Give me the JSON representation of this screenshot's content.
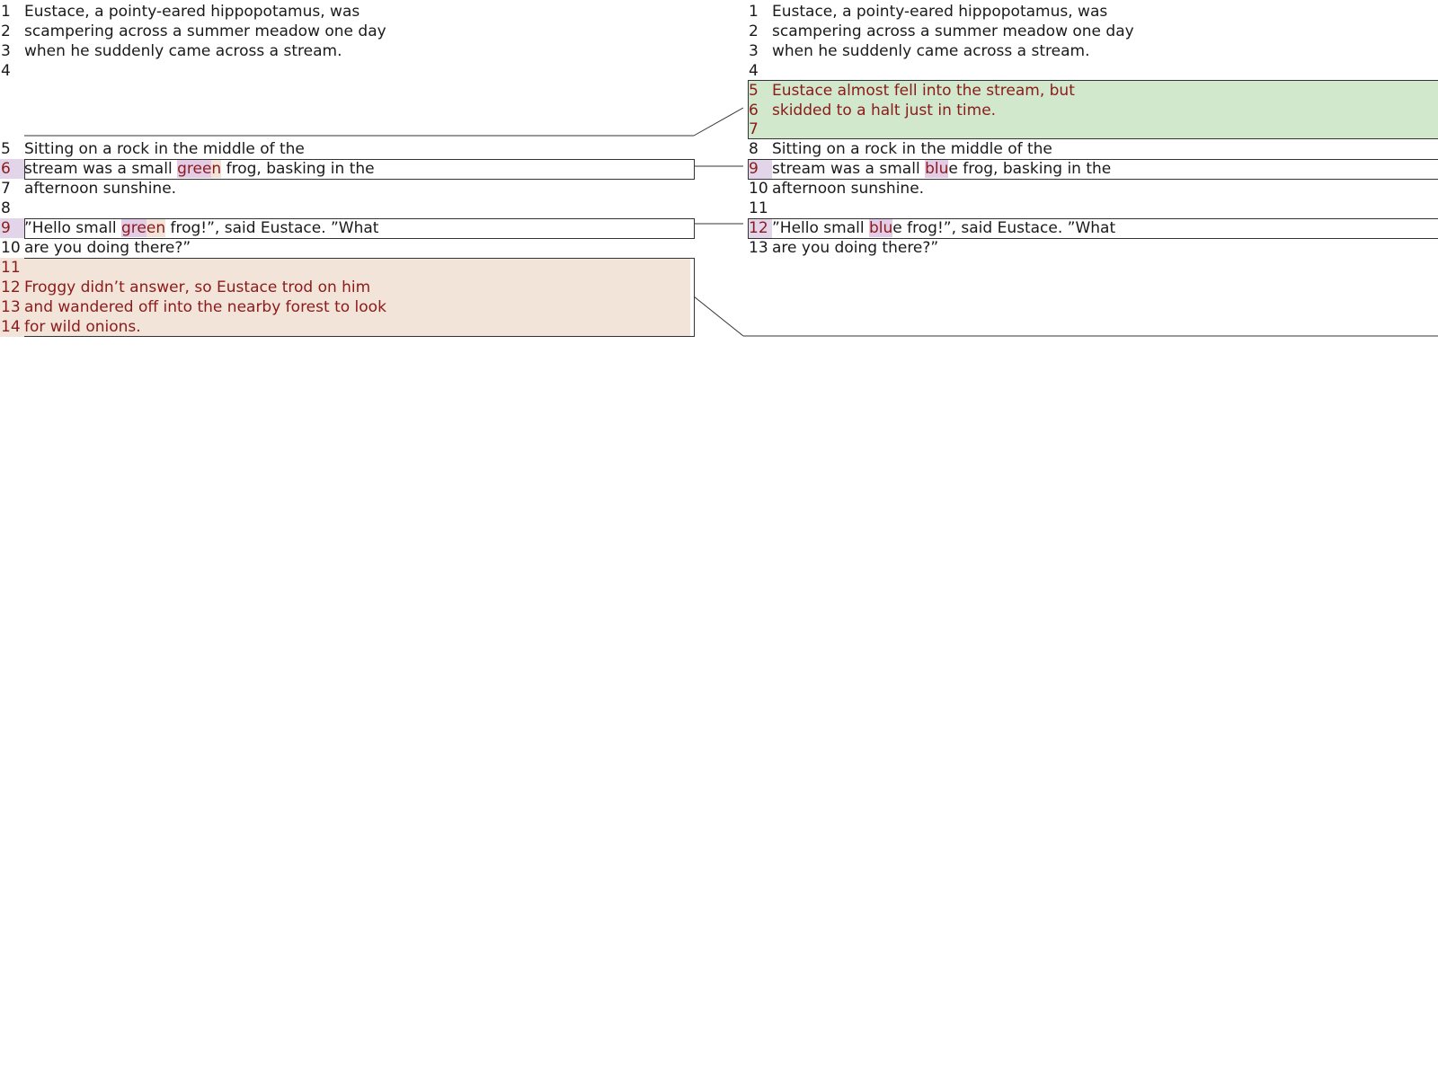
{
  "left": {
    "l1": {
      "num": "1",
      "text": "Eustace, a pointy-eared hippopotamus, was"
    },
    "l2": {
      "num": "2",
      "text": "scampering across a summer meadow one day"
    },
    "l3": {
      "num": "3",
      "text": "when he suddenly came across a stream."
    },
    "l4": {
      "num": "4",
      "text": ""
    },
    "l5": {
      "num": "5",
      "text": "Sitting on a rock in the middle of the"
    },
    "l6": {
      "num": "6",
      "pre": "stream was a small ",
      "changed": "gree",
      "tail": "n",
      "post": " frog, basking in the"
    },
    "l7": {
      "num": "7",
      "text": "afternoon sunshine."
    },
    "l8": {
      "num": "8",
      "text": ""
    },
    "l9": {
      "num": "9",
      "pre": "”Hello small ",
      "changed": "gre",
      "tail": "en",
      "post": " frog!”, said Eustace. ”What"
    },
    "l10": {
      "num": "10",
      "text": "are you doing there?”"
    },
    "l11": {
      "num": "11",
      "text": ""
    },
    "l12": {
      "num": "12",
      "text": "Froggy didn’t answer, so Eustace trod on him"
    },
    "l13": {
      "num": "13",
      "text": "and wandered off into the nearby forest to look"
    },
    "l14": {
      "num": "14",
      "text": "for wild onions."
    }
  },
  "right": {
    "l1": {
      "num": "1",
      "text": "Eustace, a pointy-eared hippopotamus, was"
    },
    "l2": {
      "num": "2",
      "text": "scampering across a summer meadow one day"
    },
    "l3": {
      "num": "3",
      "text": "when he suddenly came across a stream."
    },
    "l4": {
      "num": "4",
      "text": ""
    },
    "l5": {
      "num": "5",
      "text": "Eustace almost fell into the stream, but"
    },
    "l6": {
      "num": "6",
      "text": "skidded to a halt just in time."
    },
    "l7": {
      "num": "7",
      "text": ""
    },
    "l8": {
      "num": "8",
      "text": "Sitting on a rock in the middle of the"
    },
    "l9": {
      "num": "9",
      "pre": "stream was a small ",
      "changed": "blu",
      "tail": "e",
      "post": " frog, basking in the"
    },
    "l10": {
      "num": "10",
      "text": "afternoon sunshine."
    },
    "l11": {
      "num": "11",
      "text": ""
    },
    "l12": {
      "num": "12",
      "pre": "”Hello small ",
      "changed": "blu",
      "tail": "e",
      "post": " frog!”, said Eustace. ”What"
    },
    "l13": {
      "num": "13",
      "text": "are you doing there?”"
    }
  },
  "colors": {
    "deleted_block": "#f3e4da",
    "inserted_block": "#d1e8cd",
    "changed_word": "#e3cce6",
    "changed_text": "#8b1a1a",
    "border": "#333333"
  }
}
